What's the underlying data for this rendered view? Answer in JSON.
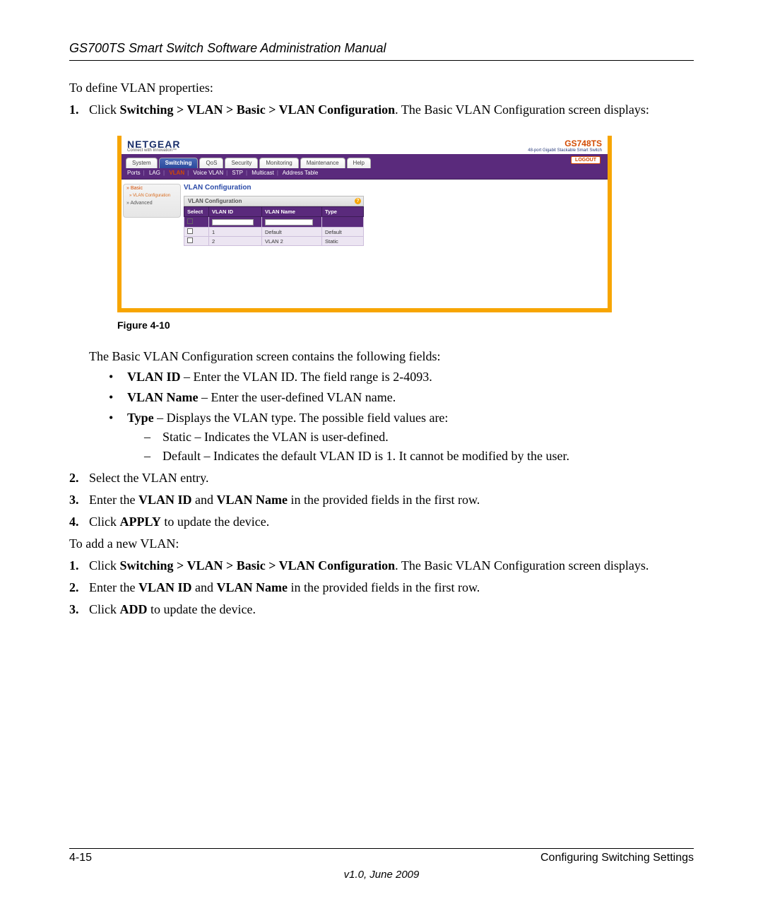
{
  "header": {
    "title": "GS700TS Smart Switch Software Administration Manual"
  },
  "intro": "To define VLAN properties:",
  "step1": {
    "num": "1.",
    "pre": "Click ",
    "path": "Switching > VLAN > Basic > VLAN Configuration",
    "post": ". The Basic VLAN Configuration screen displays:"
  },
  "figure": {
    "caption": "Figure 4-10",
    "brand": "NETGEAR",
    "tagline": "Connect with Innovation™",
    "model": "GS748TS",
    "model_desc": "48-port Gigabit Stackable Smart Switch",
    "tabs": [
      "System",
      "Switching",
      "QoS",
      "Security",
      "Monitoring",
      "Maintenance",
      "Help"
    ],
    "logout": "LOGOUT",
    "subnav": [
      "Ports",
      "LAG",
      "VLAN",
      "Voice VLAN",
      "STP",
      "Multicast",
      "Address Table"
    ],
    "subnav_active": "VLAN",
    "sidebar": {
      "items": [
        "» Basic",
        "» VLAN Configuration",
        "» Advanced"
      ],
      "active": "» VLAN Configuration"
    },
    "panel_title": "VLAN Configuration",
    "panel_header": "VLAN Configuration",
    "help_icon": "?",
    "columns": [
      "Select",
      "VLAN ID",
      "VLAN Name",
      "Type"
    ],
    "rows": [
      {
        "id": "1",
        "name": "Default",
        "type": "Default"
      },
      {
        "id": "2",
        "name": "VLAN 2",
        "type": "Static"
      }
    ]
  },
  "after_fig": "The Basic VLAN Configuration screen contains the following fields:",
  "fields": {
    "vlanid": {
      "term": "VLAN ID",
      "desc": " – Enter the VLAN ID. The field range is 2-4093."
    },
    "vlanname": {
      "term": "VLAN Name",
      "desc": " – Enter the user-defined VLAN name."
    },
    "type": {
      "term": "Type",
      "desc": " – Displays the VLAN type. The possible field values are:"
    },
    "type_values": [
      "Static – Indicates the VLAN is user-defined.",
      "Default – Indicates the default VLAN ID is 1. It cannot be modified by the user."
    ]
  },
  "step2": {
    "num": "2.",
    "text": "Select the VLAN entry."
  },
  "step3": {
    "num": "3.",
    "pre": "Enter the ",
    "b1": "VLAN ID",
    "mid": " and ",
    "b2": "VLAN Name",
    "post": " in the provided fields in the first row."
  },
  "step4": {
    "num": "4.",
    "pre": "Click ",
    "b": "APPLY",
    "post": " to update the device."
  },
  "add_intro": "To add a new VLAN:",
  "add1": {
    "num": "1.",
    "pre": "Click ",
    "path": "Switching > VLAN > Basic > VLAN Configuration",
    "post": ". The Basic VLAN Configuration screen displays."
  },
  "add2": {
    "num": "2.",
    "pre": "Enter the ",
    "b1": "VLAN ID",
    "mid": " and ",
    "b2": "VLAN Name",
    "post": " in the provided fields in the first row."
  },
  "add3": {
    "num": "3.",
    "pre": "Click ",
    "b": "ADD",
    "post": " to update the device."
  },
  "footer": {
    "page": "4-15",
    "section": "Configuring Switching Settings",
    "version": "v1.0, June 2009"
  }
}
